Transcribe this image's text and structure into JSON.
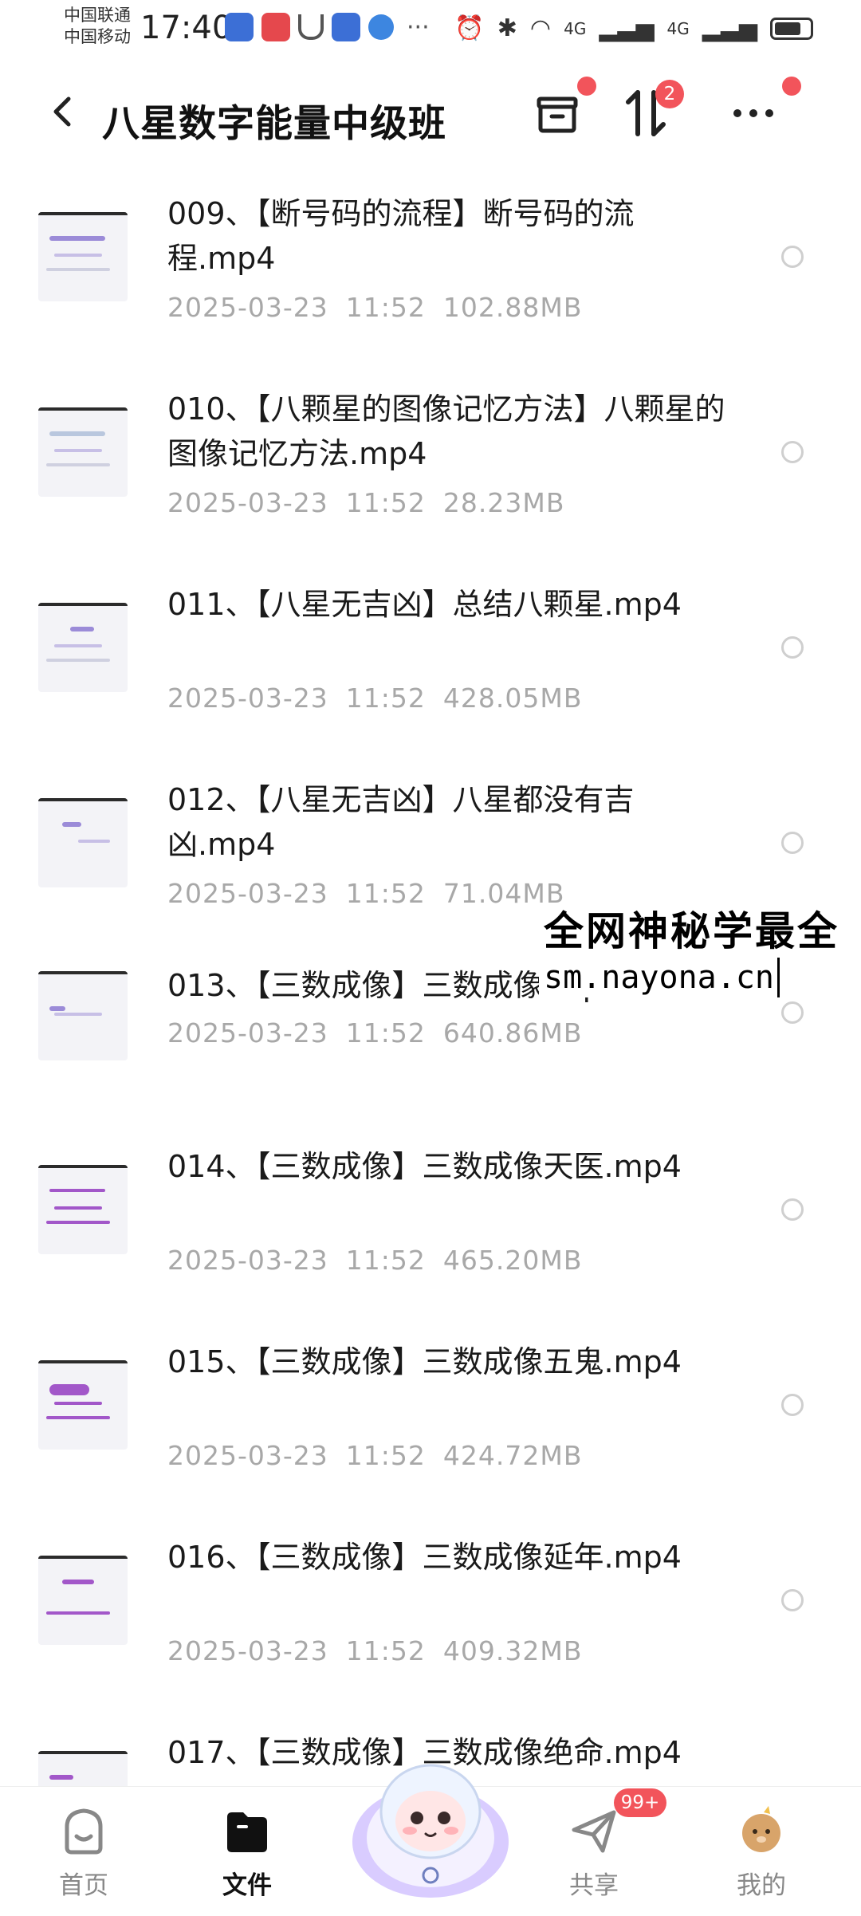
{
  "status_bar": {
    "carrier1": "中国联通",
    "carrier2": "中国移动",
    "time": "17:40",
    "network1": "4G",
    "network2": "4G",
    "battery_level": 0.75
  },
  "header": {
    "title": "八星数字能量中级班",
    "sort_badge": "2"
  },
  "files": [
    {
      "name": "009、【断号码的流程】断号码的流程.mp4",
      "date": "2025-03-23",
      "time": "11:52",
      "size": "102.88MB"
    },
    {
      "name": "010、【八颗星的图像记忆方法】八颗星的图像记忆方法.mp4",
      "date": "2025-03-23",
      "time": "11:52",
      "size": "28.23MB"
    },
    {
      "name": "011、【八星无吉凶】总结八颗星.mp4",
      "date": "2025-03-23",
      "time": "11:52",
      "size": "428.05MB"
    },
    {
      "name": "012、【八星无吉凶】八星都没有吉凶.mp4",
      "date": "2025-03-23",
      "time": "11:52",
      "size": "71.04MB"
    },
    {
      "name": "013、【三数成像】三数成像.mp4",
      "date": "2025-03-23",
      "time": "11:52",
      "size": "640.86MB"
    },
    {
      "name": "014、【三数成像】三数成像天医.mp4",
      "date": "2025-03-23",
      "time": "11:52",
      "size": "465.20MB"
    },
    {
      "name": "015、【三数成像】三数成像五鬼.mp4",
      "date": "2025-03-23",
      "time": "11:52",
      "size": "424.72MB"
    },
    {
      "name": "016、【三数成像】三数成像延年.mp4",
      "date": "2025-03-23",
      "time": "11:52",
      "size": "409.32MB"
    },
    {
      "name": "017、【三数成像】三数成像绝命.mp4",
      "date": "",
      "time": "",
      "size": ""
    }
  ],
  "watermark": {
    "line1": "全网神秘学最全",
    "line2": "sm.nayona.cn"
  },
  "bottom_nav": {
    "home": "首页",
    "files": "文件",
    "share": "共享",
    "share_badge": "99+",
    "mine": "我的"
  },
  "colors": {
    "badge": "#f2545b",
    "meta_text": "#a8a8a8"
  }
}
